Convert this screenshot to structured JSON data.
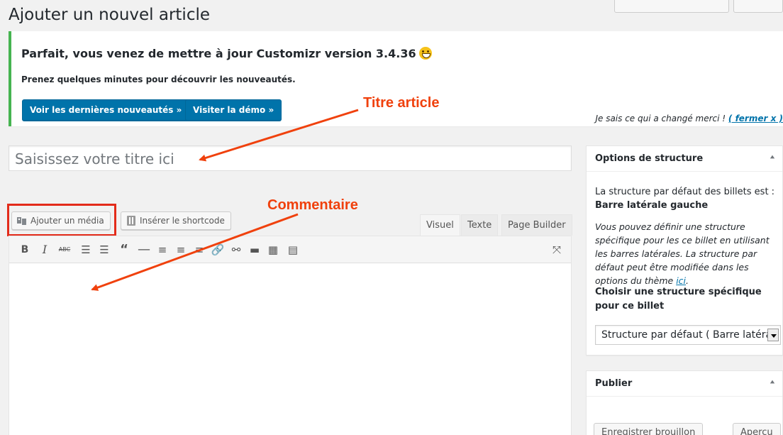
{
  "page": {
    "title": "Ajouter un nouvel article"
  },
  "notice": {
    "title": "Parfait, vous venez de mettre à jour Customizr version 3.4.36",
    "description": "Prenez quelques minutes pour découvrir les nouveautés.",
    "button_news": "Voir les dernières nouveautés »",
    "button_demo": "Visiter la démo »",
    "dismiss_text": "Je sais ce qui a changé merci ! ",
    "dismiss_link": "( fermer x )",
    "accent_color": "#46b450"
  },
  "annotations": {
    "title_article": "Titre article",
    "commentaire": "Commentaire",
    "color": "#f0410d"
  },
  "editor": {
    "title_placeholder": "Saisissez votre titre ici",
    "add_media_label": "Ajouter un média",
    "shortcode_label": "Insérer le shortcode",
    "tabs": [
      "Visuel",
      "Texte",
      "Page Builder"
    ],
    "toolbar_icons": [
      "bold-icon",
      "italic-icon",
      "strikethrough-icon",
      "bullet-list-icon",
      "numbered-list-icon",
      "blockquote-icon",
      "horizontal-rule-icon",
      "align-left-icon",
      "align-center-icon",
      "align-right-icon",
      "link-icon",
      "unlink-icon",
      "read-more-icon",
      "toolbar-toggle-icon",
      "shortcode-icon",
      "fullscreen-icon"
    ]
  },
  "sidebar": {
    "layout_box": {
      "title": "Options de structure",
      "default_text": "La structure par défaut des billets est :",
      "default_value": "Barre latérale gauche",
      "help_text": "Vous pouvez définir une structure spécifique pour les ce billet en utilisant les barres latérales. La structure par défaut peut être modifiée dans les options du thème ",
      "help_link": "ici",
      "help_end": ".",
      "choose_label": "Choisir une structure spécifique pour ce billet",
      "select_value": "Structure par défaut ( Barre latérale"
    },
    "publish_box": {
      "title": "Publier",
      "save_draft": "Enregistrer brouillon",
      "preview": "Aperçu"
    }
  }
}
